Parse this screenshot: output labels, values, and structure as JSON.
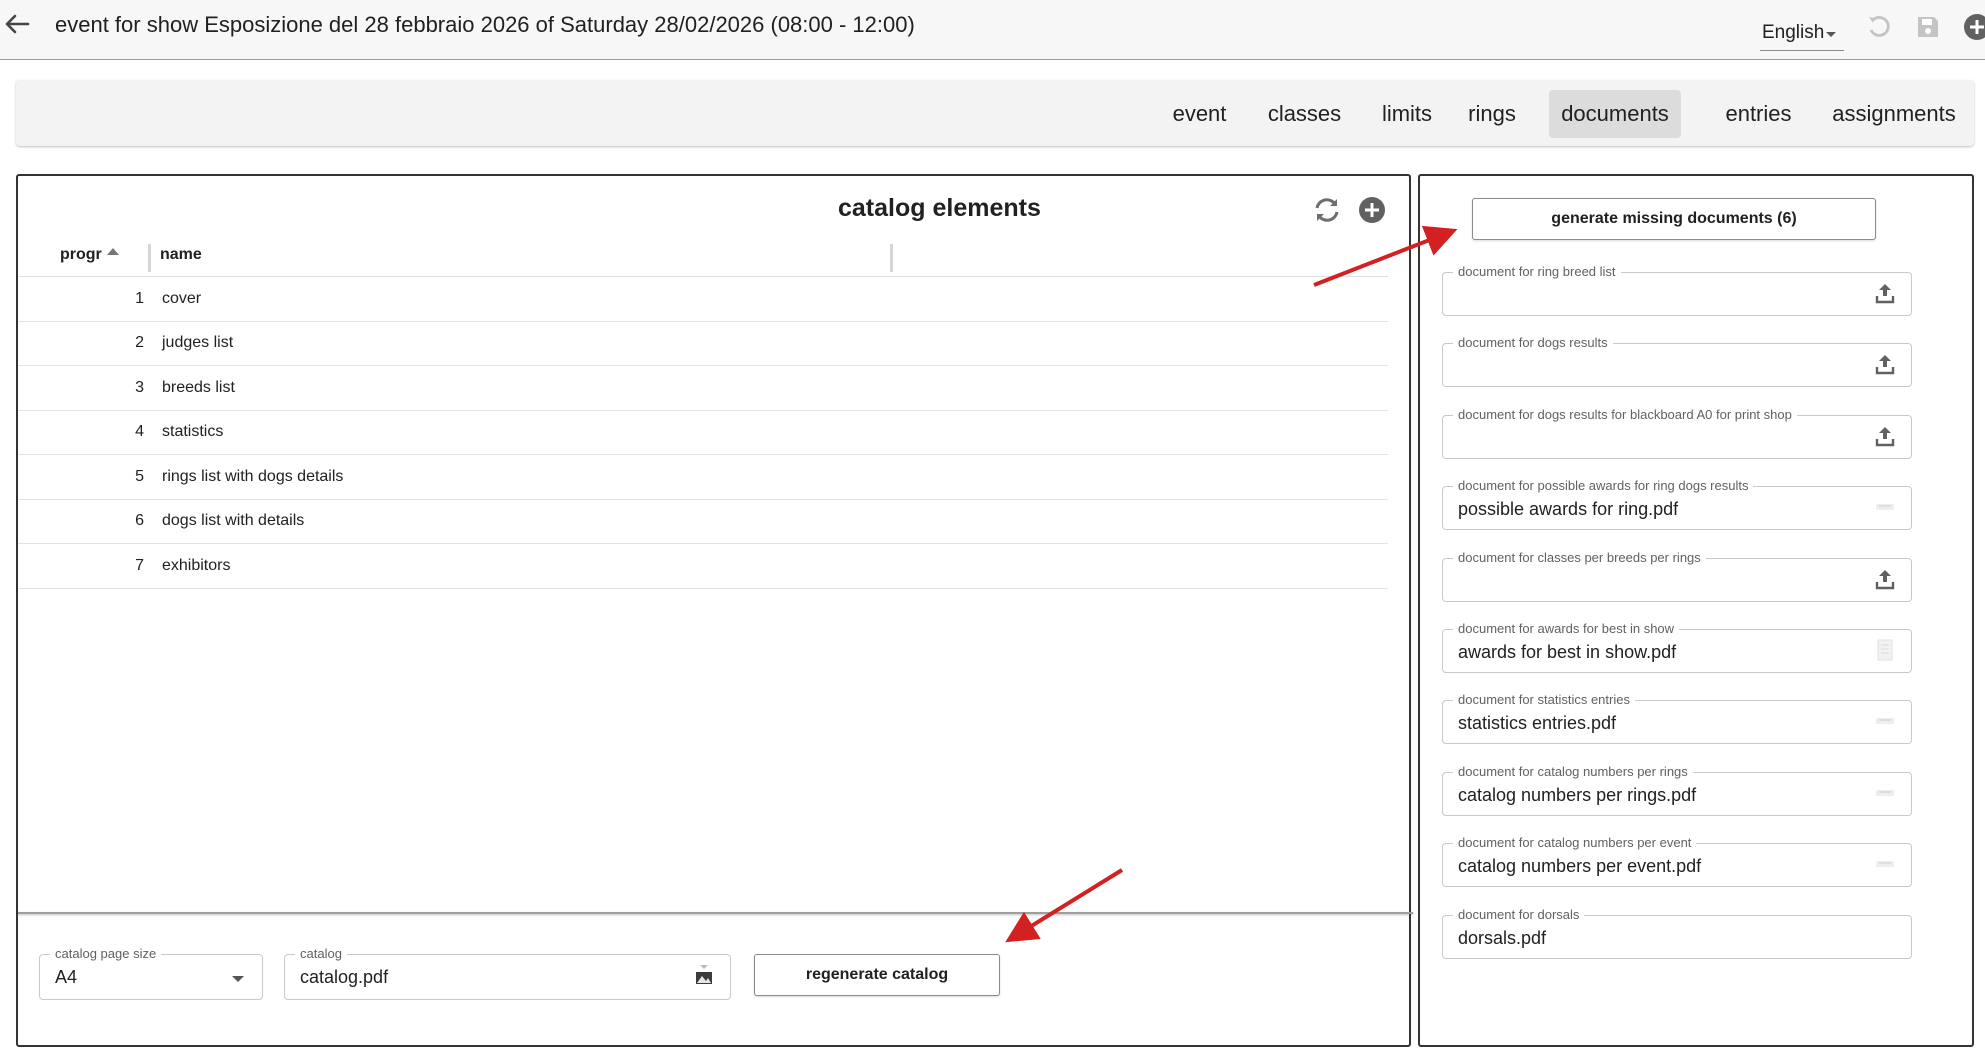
{
  "header": {
    "title": "event for show Esposizione del 28 febbraio 2026 of Saturday 28/02/2026 (08:00 - 12:00)",
    "language": "English"
  },
  "tabs": [
    {
      "label": "event"
    },
    {
      "label": "classes"
    },
    {
      "label": "limits"
    },
    {
      "label": "rings"
    },
    {
      "label": "documents",
      "active": true
    },
    {
      "label": "entries"
    },
    {
      "label": "assignments"
    }
  ],
  "catalog": {
    "title": "catalog elements",
    "columns": {
      "progr": "progr",
      "name": "name"
    },
    "rows": [
      {
        "progr": "1",
        "name": "cover"
      },
      {
        "progr": "2",
        "name": "judges list"
      },
      {
        "progr": "3",
        "name": "breeds list"
      },
      {
        "progr": "4",
        "name": "statistics"
      },
      {
        "progr": "5",
        "name": "rings list with dogs details"
      },
      {
        "progr": "6",
        "name": "dogs list with details"
      },
      {
        "progr": "7",
        "name": "exhibitors"
      }
    ],
    "page_size": {
      "label": "catalog page size",
      "value": "A4"
    },
    "catalog_file": {
      "label": "catalog",
      "value": "catalog.pdf"
    },
    "regenerate_label": "regenerate catalog"
  },
  "documents": {
    "generate_label": "generate missing documents (6)",
    "fields": [
      {
        "label": "document for ring breed list",
        "value": ""
      },
      {
        "label": "document for dogs results",
        "value": ""
      },
      {
        "label": "document for dogs results for blackboard A0 for print shop",
        "value": ""
      },
      {
        "label": "document for possible awards for ring dogs results",
        "value": "possible awards for ring.pdf"
      },
      {
        "label": "document for classes per breeds per rings",
        "value": ""
      },
      {
        "label": "document for awards for best in show",
        "value": "awards for best in show.pdf"
      },
      {
        "label": "document for statistics entries",
        "value": "statistics entries.pdf"
      },
      {
        "label": "document for catalog numbers per rings",
        "value": "catalog numbers per rings.pdf"
      },
      {
        "label": "document for catalog numbers per event",
        "value": "catalog numbers per event.pdf"
      },
      {
        "label": "document for dorsals",
        "value": "dorsals.pdf"
      }
    ]
  },
  "colors": {
    "accent_arrow": "#d32020",
    "tab_active_bg": "#dcdcdc",
    "topbar_bg": "#f7f7f7"
  }
}
